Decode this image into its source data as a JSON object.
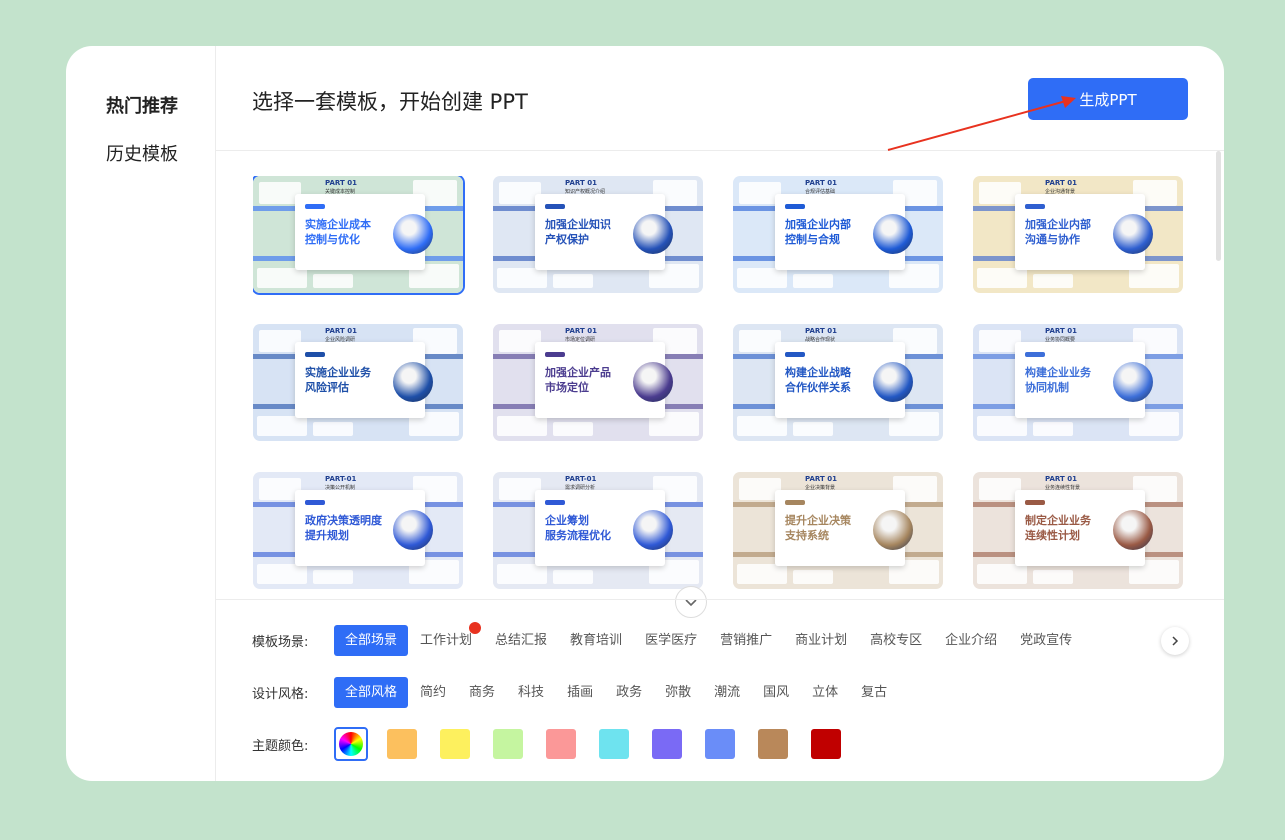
{
  "sidebar": {
    "items": [
      {
        "label": "热门推荐",
        "active": true
      },
      {
        "label": "历史模板",
        "active": false
      }
    ]
  },
  "header": {
    "title": "选择一套模板，开始创建 PPT",
    "generate_button": "生成PPT"
  },
  "templates": [
    {
      "part": "PART 01",
      "sub": "关键成本控制",
      "title1": "实施企业成本",
      "title2": "控制与优化",
      "accent": "#2f6df6",
      "bg": "#cfe5d7",
      "selected": true
    },
    {
      "part": "PART 01",
      "sub": "知识产权概况介绍",
      "title1": "加强企业知识",
      "title2": "产权保护",
      "accent": "#2552b8",
      "bg": "#dfe7f3",
      "selected": false
    },
    {
      "part": "PART 01",
      "sub": "合规评估基础",
      "title1": "加强企业内部",
      "title2": "控制与合规",
      "accent": "#1f5bd6",
      "bg": "#dbe8f8",
      "selected": false
    },
    {
      "part": "PART 01",
      "sub": "企业沟通背景",
      "title1": "加强企业内部",
      "title2": "沟通与协作",
      "accent": "#2f5fd0",
      "bg": "#f2e7c6",
      "selected": false
    },
    {
      "part": "PART 01",
      "sub": "企业风险调研",
      "title1": "实施企业业务",
      "title2": "风险评估",
      "accent": "#1e4fa8",
      "bg": "#d7e3f4",
      "selected": false
    },
    {
      "part": "PART 01",
      "sub": "市场定位调研",
      "title1": "加强企业产品",
      "title2": "市场定位",
      "accent": "#4b3c8f",
      "bg": "#e1e0ee",
      "selected": false
    },
    {
      "part": "PART 01",
      "sub": "战略合作现状",
      "title1": "构建企业战略",
      "title2": "合作伙伴关系",
      "accent": "#2358c4",
      "bg": "#dde6f3",
      "selected": false
    },
    {
      "part": "PART 01",
      "sub": "业务协同概要",
      "title1": "构建企业业务",
      "title2": "协同机制",
      "accent": "#3d6fd9",
      "bg": "#dbe4f5",
      "selected": false
    },
    {
      "part": "PART-01",
      "sub": "决策公开机制",
      "title1": "政府决策透明度",
      "title2": "提升规划",
      "accent": "#2f59d6",
      "bg": "#e3e9f6",
      "selected": false
    },
    {
      "part": "PART-01",
      "sub": "需求调研分析",
      "title1": "企业筹划",
      "title2": "服务流程优化",
      "accent": "#2f59d6",
      "bg": "#e5e9f3",
      "selected": false
    },
    {
      "part": "PART 01",
      "sub": "企业决策背景",
      "title1": "提升企业决策",
      "title2": "支持系统",
      "accent": "#a6865f",
      "bg": "#ece4d8",
      "selected": false
    },
    {
      "part": "PART 01",
      "sub": "业务连续性背景",
      "title1": "制定企业业务",
      "title2": "连续性计划",
      "accent": "#9a5a45",
      "bg": "#ece3dc",
      "selected": false
    }
  ],
  "filters": {
    "scene": {
      "label": "模板场景:",
      "options": [
        "全部场景",
        "工作计划",
        "总结汇报",
        "教育培训",
        "医学医疗",
        "营销推广",
        "商业计划",
        "高校专区",
        "企业介绍",
        "党政宣传"
      ],
      "active_index": 0,
      "hot_index": 1
    },
    "style": {
      "label": "设计风格:",
      "options": [
        "全部风格",
        "简约",
        "商务",
        "科技",
        "插画",
        "政务",
        "弥散",
        "潮流",
        "国风",
        "立体",
        "复古"
      ],
      "active_index": 0
    },
    "color": {
      "label": "主题颜色:",
      "swatches": [
        "all",
        "#fcc05e",
        "#fdf05e",
        "#c5f5a0",
        "#fb9898",
        "#6ee3ef",
        "#7a6af5",
        "#6a8df8",
        "#b9885a",
        "#c00000"
      ],
      "active_index": 0
    }
  },
  "icons": {
    "expand": "chevron-down-icon",
    "next": "chevron-right-icon",
    "annotation": "red-arrow-icon"
  }
}
